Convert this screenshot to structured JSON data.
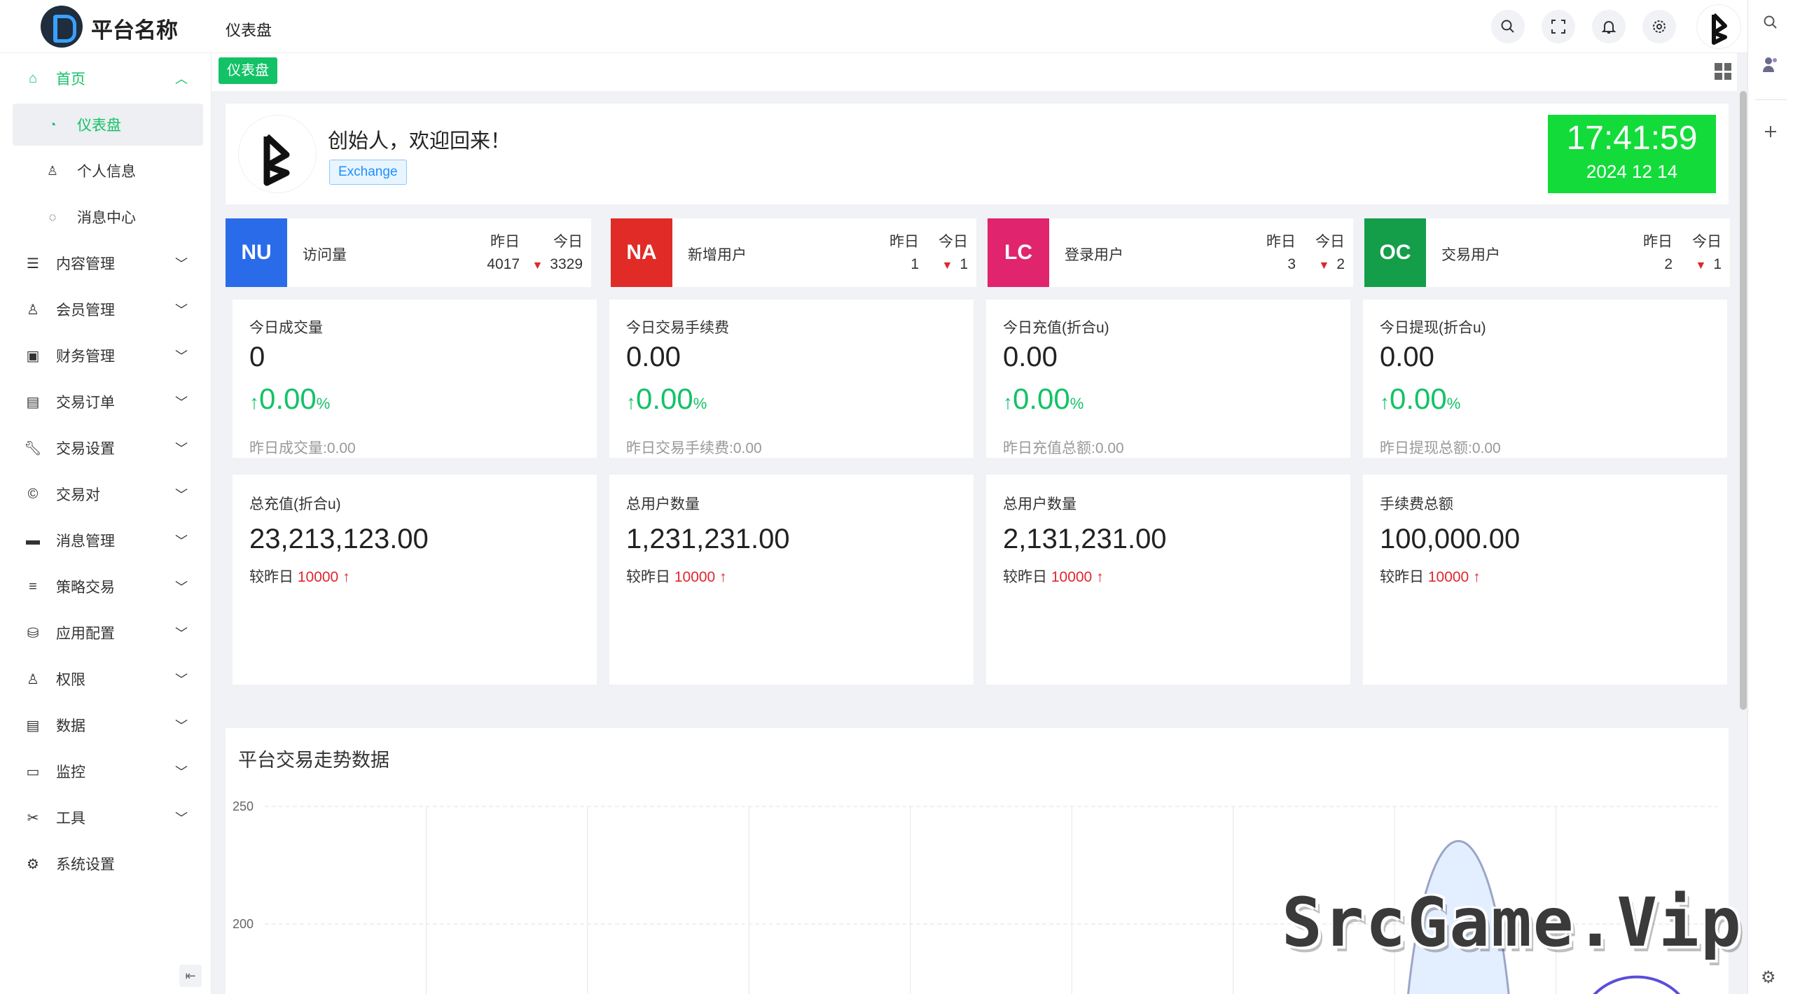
{
  "header": {
    "platform_name": "平台名称",
    "title": "仪表盘"
  },
  "header_icons": [
    "search-icon",
    "fullscreen-icon",
    "bell-icon",
    "gear-icon"
  ],
  "sidebar": {
    "home": {
      "label": "首页",
      "icon": "home-icon"
    },
    "home_sub": [
      {
        "label": "仪表盘",
        "icon": "dashboard-icon"
      },
      {
        "label": "个人信息",
        "icon": "user-icon"
      },
      {
        "label": "消息中心",
        "icon": "message-icon"
      }
    ],
    "items": [
      {
        "label": "内容管理",
        "icon": "list-icon"
      },
      {
        "label": "会员管理",
        "icon": "member-icon"
      },
      {
        "label": "财务管理",
        "icon": "finance-icon"
      },
      {
        "label": "交易订单",
        "icon": "order-icon"
      },
      {
        "label": "交易设置",
        "icon": "wrench-icon"
      },
      {
        "label": "交易对",
        "icon": "copyright-icon"
      },
      {
        "label": "消息管理",
        "icon": "mail-icon"
      },
      {
        "label": "策略交易",
        "icon": "menu-icon"
      },
      {
        "label": "应用配置",
        "icon": "app-config-icon"
      },
      {
        "label": "权限",
        "icon": "permission-icon"
      },
      {
        "label": "数据",
        "icon": "data-icon"
      },
      {
        "label": "监控",
        "icon": "monitor-icon"
      },
      {
        "label": "工具",
        "icon": "tool-icon"
      },
      {
        "label": "系统设置",
        "icon": "system-gear-icon"
      }
    ]
  },
  "tagbar": {
    "active_tag": "仪表盘"
  },
  "welcome": {
    "greeting": "创始人，欢迎回来！",
    "tag": "Exchange"
  },
  "clock": {
    "time": "17:41:59",
    "date": "2024 12 14"
  },
  "colors": {
    "accent": "#13c267",
    "clock": "#13dc3a",
    "nu": "#2a6be9",
    "na": "#e02b27",
    "lc": "#e0246e",
    "oc": "#149e49",
    "down": "#e0262f"
  },
  "strips": [
    {
      "badge": "NU",
      "name": "访问量",
      "yesterday_label": "昨日",
      "today_label": "今日",
      "yesterday": "4017",
      "today": "3329"
    },
    {
      "badge": "NA",
      "name": "新增用户",
      "yesterday_label": "昨日",
      "today_label": "今日",
      "yesterday": "1",
      "today": "1"
    },
    {
      "badge": "LC",
      "name": "登录用户",
      "yesterday_label": "昨日",
      "today_label": "今日",
      "yesterday": "3",
      "today": "2"
    },
    {
      "badge": "OC",
      "name": "交易用户",
      "yesterday_label": "昨日",
      "today_label": "今日",
      "yesterday": "2",
      "today": "1"
    }
  ],
  "today_cards": [
    {
      "title": "今日成交量",
      "value": "0",
      "pct": "0.00",
      "unit": "%",
      "sub": "昨日成交量:0.00"
    },
    {
      "title": "今日交易手续费",
      "value": "0.00",
      "pct": "0.00",
      "unit": "%",
      "sub": "昨日交易手续费:0.00"
    },
    {
      "title": "今日充值(折合u)",
      "value": "0.00",
      "pct": "0.00",
      "unit": "%",
      "sub": "昨日充值总额:0.00"
    },
    {
      "title": "今日提现(折合u)",
      "value": "0.00",
      "pct": "0.00",
      "unit": "%",
      "sub": "昨日提现总额:0.00"
    }
  ],
  "total_cards": [
    {
      "title": "总充值(折合u)",
      "value": "23,213,123.00",
      "cmp_label": "较昨日",
      "cmp_value": "10000"
    },
    {
      "title": "总用户数量",
      "value": "1,231,231.00",
      "cmp_label": "较昨日",
      "cmp_value": "10000"
    },
    {
      "title": "总用户数量",
      "value": "2,131,231.00",
      "cmp_label": "较昨日",
      "cmp_value": "10000"
    },
    {
      "title": "手续费总额",
      "value": "100,000.00",
      "cmp_label": "较昨日",
      "cmp_value": "10000"
    }
  ],
  "chart_data": {
    "type": "area",
    "title": "平台交易走势数据",
    "ylim_visible_top": 250,
    "y_ticks": [
      "250",
      "200"
    ],
    "category_count": 9,
    "series": [
      {
        "values_visible": [
          0,
          0,
          0,
          0,
          0,
          0,
          0,
          247,
          0
        ],
        "color": "#9aa5c8"
      },
      {
        "values_visible": [
          0,
          0,
          0,
          0,
          0,
          0,
          0,
          0,
          170
        ],
        "color": "#5b4dd8"
      }
    ]
  },
  "watermark": "SrcGame.Vip"
}
